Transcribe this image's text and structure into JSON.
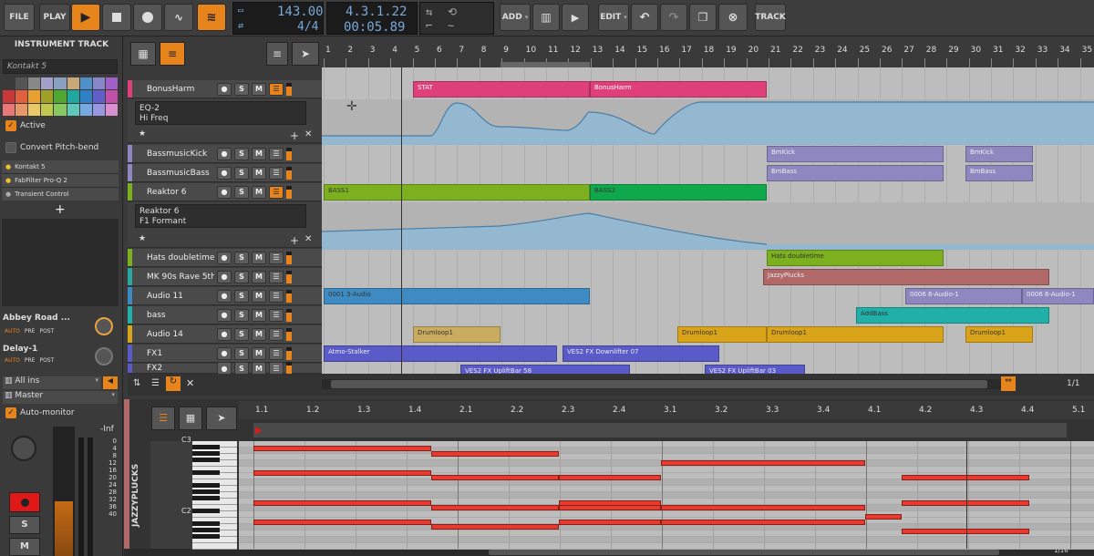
{
  "topbar": {
    "file": "FILE",
    "play_menu": "PLAY",
    "tempo": "143.00",
    "time_sig": "4/4",
    "position": "4.3.1.22",
    "time": "00:05.89",
    "add": "ADD",
    "edit": "EDIT",
    "track": "TRACK"
  },
  "inspector": {
    "header": "INSTRUMENT TRACK",
    "device_field": "Kontakt 5",
    "active_label": "Active",
    "convert_label": "Convert Pitch-bend",
    "devices": [
      "Kontakt 5",
      "FabFilter Pro-Q 2",
      "Transient Control"
    ],
    "sends": [
      {
        "name": "Abbey Road ...",
        "labels": [
          "AUTO",
          "PRE",
          "POST"
        ]
      },
      {
        "name": "Delay-1",
        "labels": [
          "AUTO",
          "PRE",
          "POST"
        ]
      }
    ],
    "input": "All ins",
    "output": "Master",
    "auto_monitor": "Auto-monitor",
    "meter_db": "-Inf",
    "meter_scale": [
      "0",
      "4",
      "8",
      "12",
      "16",
      "20",
      "24",
      "28",
      "32",
      "36",
      "40"
    ],
    "solo": "S",
    "mute": "M"
  },
  "ruler": {
    "bars": [
      "1",
      "2",
      "3",
      "4",
      "5",
      "6",
      "7",
      "8",
      "9",
      "10",
      "11",
      "12",
      "13",
      "14",
      "15",
      "16",
      "17",
      "18",
      "19",
      "20",
      "21",
      "22",
      "23",
      "24",
      "25",
      "26",
      "27",
      "28",
      "29",
      "30",
      "31",
      "32",
      "33",
      "34",
      "35"
    ]
  },
  "tracks": [
    {
      "name": "BonusHarm",
      "color": "#e0407a"
    },
    {
      "name": "EQ-2",
      "sub": "Hi Freq",
      "automation": true
    },
    {
      "name": "BassmusicKick",
      "color": "#8f88c0"
    },
    {
      "name": "BassmusicBass",
      "color": "#8f88c0"
    },
    {
      "name": "Reaktor 6",
      "color": "#7cb01e"
    },
    {
      "name": "Reaktor 6",
      "sub": "F1 Formant",
      "automation": true
    },
    {
      "name": "Hats doubletime",
      "color": "#7cb01e"
    },
    {
      "name": "MK 90s Rave 5th",
      "color": "#2aa8a0"
    },
    {
      "name": "Audio 11",
      "color": "#3d8bc2"
    },
    {
      "name": "bass",
      "color": "#20b0a8"
    },
    {
      "name": "Audio 14",
      "color": "#d9a41a"
    },
    {
      "name": "FX1",
      "color": "#5a5ac8"
    },
    {
      "name": "FX2",
      "color": "#5a5ac8"
    }
  ],
  "clips": {
    "stat": "STAT",
    "bonusharm": "BonusHarm",
    "bmkick": "BmKick",
    "bmkick2": "BmKick",
    "bmbass": "BmBass",
    "bmbass2": "BmBass",
    "bass1": "BASS1",
    "bass2": "BASS2",
    "hats": "Hats doubletime",
    "jazzy": "JazzyPlucks",
    "audio11a": "0001 3-Audio",
    "audio11b": "0006 6-Audio-1",
    "audio11c": "0006 6-Audio-1",
    "addbass": "AddBass",
    "drum1": "Drumloop1",
    "drum2": "Drumloop1",
    "drum3": "Drumloop1",
    "drum4": "Drumloop1",
    "atmo": "Atmo-Stalker",
    "downlifter": "VES2 FX Downlifter 07",
    "uplifter1": "VES2 FX UpliftBar 58",
    "uplifter2": "VES2 FX UpliftBar 03"
  },
  "zoom": "1/1",
  "editor": {
    "clip_name": "JAZZYPLUCKS",
    "ruler": [
      "1.1",
      "1.2",
      "1.3",
      "1.4",
      "2.1",
      "2.2",
      "2.3",
      "2.4",
      "3.1",
      "3.2",
      "3.3",
      "3.4",
      "4.1",
      "4.2",
      "4.3",
      "4.4",
      "5.1"
    ],
    "key_c3": "C3",
    "key_c2": "C2",
    "zoom": "1/16"
  }
}
